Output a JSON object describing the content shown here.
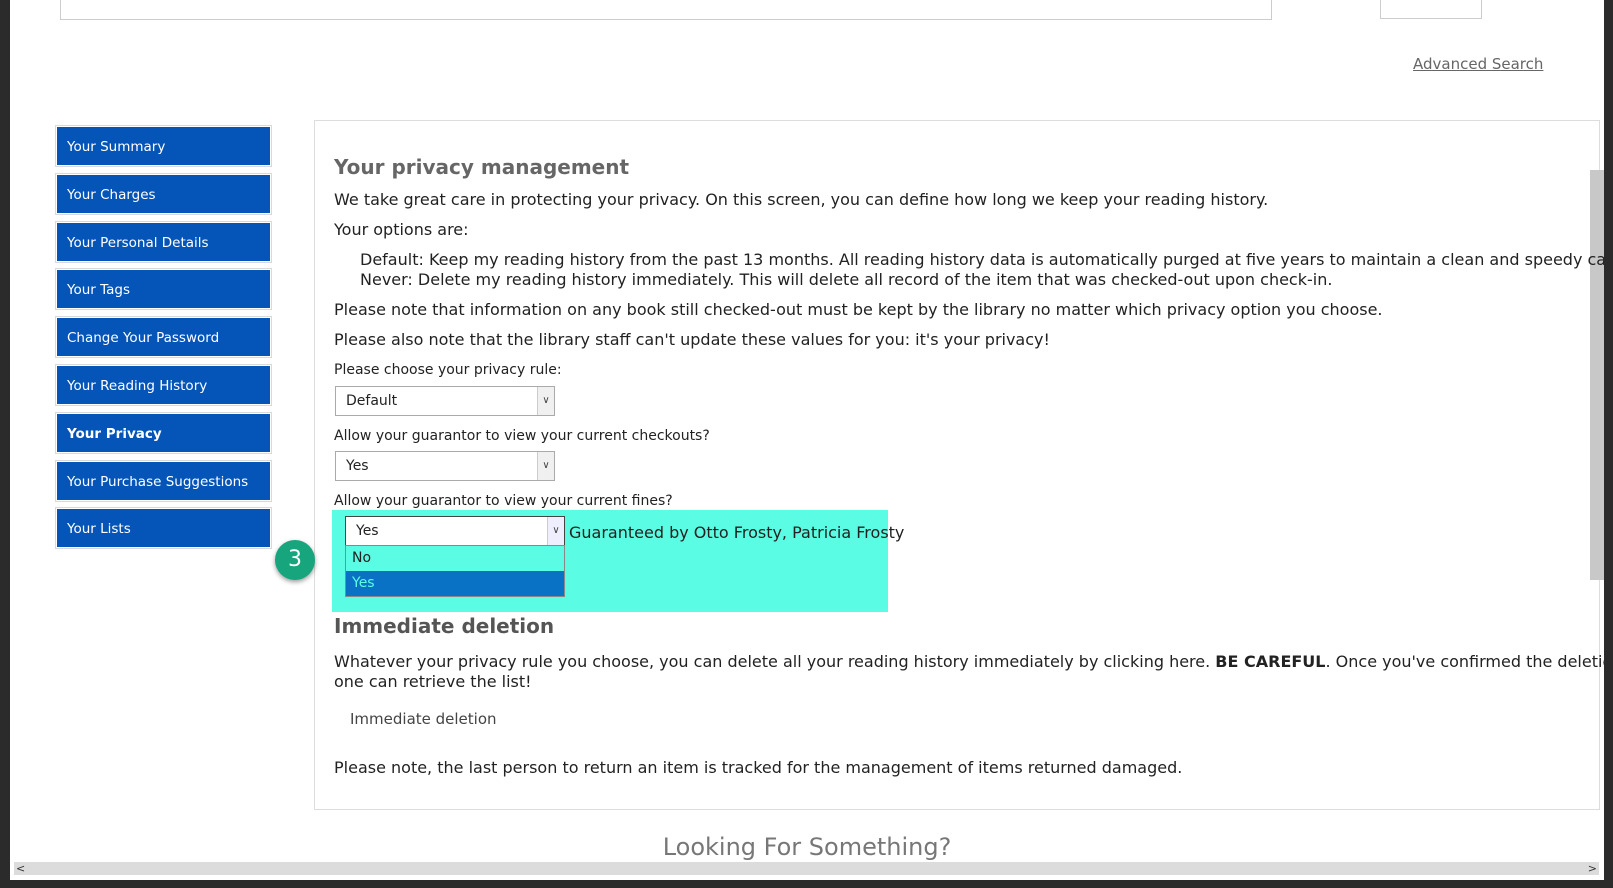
{
  "header": {
    "advanced_search": "Advanced Search"
  },
  "sidebar": {
    "items": [
      {
        "label": "Your Summary"
      },
      {
        "label": "Your Charges"
      },
      {
        "label": "Your Personal Details"
      },
      {
        "label": "Your Tags"
      },
      {
        "label": "Change Your Password"
      },
      {
        "label": "Your Reading History"
      },
      {
        "label": "Your Privacy",
        "active": true
      },
      {
        "label": "Your Purchase Suggestions"
      },
      {
        "label": "Your Lists"
      }
    ]
  },
  "privacy": {
    "title": "Your privacy management",
    "intro": "We take great care in protecting your privacy. On this screen, you can define how long we keep your reading history.",
    "options_label": "Your options are:",
    "option_default": "Default: Keep my reading history from the past 13 months. All reading history data is automatically purged at five years to maintain a clean and speedy catalog.",
    "option_never": "Never: Delete my reading history immediately. This will delete all record of the item that was checked-out upon check-in.",
    "note1": "Please note that information on any book still checked-out must be kept by the library no matter which privacy option you choose.",
    "note2": "Please also note that the library staff can't update these values for you: it's your privacy!",
    "rule_label": "Please choose your privacy rule:",
    "rule_value": "Default",
    "checkouts_label": "Allow your guarantor to view your current checkouts?",
    "checkouts_value": "Yes",
    "fines_label": "Allow your guarantor to view your current fines?",
    "fines_value": "Yes",
    "guaranteed_by": "Guaranteed by Otto Frosty, Patricia Frosty",
    "fines_options": [
      "No",
      "Yes"
    ]
  },
  "deletion": {
    "title": "Immediate deletion",
    "text_before": "Whatever your privacy rule you choose, you can delete all your reading history immediately by clicking here. ",
    "text_bold": "BE CAREFUL",
    "text_after": ". Once you've confirmed the deletion, no",
    "text_line2": "one can retrieve the list!",
    "button": "Immediate deletion",
    "note": "Please note, the last person to return an item is tracked for the management of items returned damaged."
  },
  "footer": {
    "title": "Looking For Something?"
  },
  "step_badge": "3"
}
